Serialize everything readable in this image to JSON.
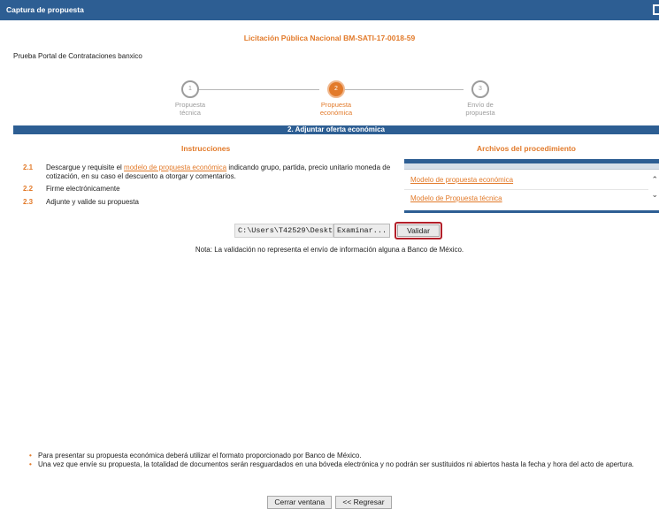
{
  "window": {
    "title": "Captura de propuesta"
  },
  "header": {
    "licitacion": "Licitación Pública Nacional BM-SATI-17-0018-59",
    "portal": "Prueba Portal de Contrataciones banxico"
  },
  "steps": [
    {
      "number": "1",
      "label_line1": "Propuesta",
      "label_line2": "técnica",
      "active": false
    },
    {
      "number": "2",
      "label_line1": "Propuesta",
      "label_line2": "económica",
      "active": true
    },
    {
      "number": "3",
      "label_line1": "Envío de",
      "label_line2": "propuesta",
      "active": false
    }
  ],
  "section": {
    "title": "2. Adjuntar oferta económica"
  },
  "instructions": {
    "title": "Instrucciones",
    "items": [
      {
        "num": "2.1",
        "pre": "Descargue y requisite el ",
        "link": "modelo de propuesta económica",
        "post": " indicando grupo, partida, precio unitario moneda de cotización, en su caso el descuento a otorgar y comentarios."
      },
      {
        "num": "2.2",
        "text": "Firme electrónicamente"
      },
      {
        "num": "2.3",
        "text": "Adjunte y valide su propuesta"
      }
    ]
  },
  "files": {
    "title": "Archivos del procedimiento",
    "items": [
      "Modelo de propuesta económica",
      "Modelo de Propuesta técnica"
    ]
  },
  "upload": {
    "path_value": "C:\\Users\\T42529\\Deskt",
    "browse_label": "Examinar...",
    "validate_label": "Validar",
    "note": "Nota: La validación no representa el envío de información alguna a Banco de México."
  },
  "notes": [
    "Para presentar su propuesta económica deberá utilizar el formato proporcionado por Banco de México.",
    "Una vez que envíe su propuesta, la totalidad de documentos serán resguardados en una bóveda electrónica y no podrán ser sustituidos ni abiertos hasta la fecha y hora del acto de apertura."
  ],
  "buttons": {
    "close_label": "Cerrar ventana",
    "back_label": "<< Regresar"
  },
  "colors": {
    "brand_blue": "#2d5e93",
    "accent_orange": "#e27a2a",
    "highlight_red": "#b3202a"
  }
}
